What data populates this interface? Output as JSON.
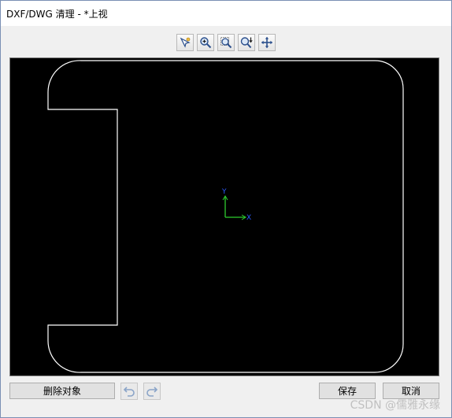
{
  "window": {
    "title": "DXF/DWG 清理 - *上视"
  },
  "toolbar": {
    "tools": [
      {
        "name": "select-pan-tool",
        "icon": "pointer-star-icon"
      },
      {
        "name": "zoom-in-tool",
        "icon": "zoom-in-icon"
      },
      {
        "name": "zoom-window-tool",
        "icon": "zoom-window-icon"
      },
      {
        "name": "zoom-fit-tool",
        "icon": "zoom-fit-icon"
      },
      {
        "name": "pan-tool",
        "icon": "move-arrows-icon"
      }
    ]
  },
  "viewport": {
    "background": "#000000",
    "outline_color": "#ffffff",
    "axis": {
      "x_label": "X",
      "y_label": "Y",
      "x_color": "#2ecc2e",
      "y_color": "#2e5cff"
    }
  },
  "buttons": {
    "delete_label": "删除对象",
    "save_label": "保存",
    "cancel_label": "取消"
  },
  "watermark": "CSDN @儒雅永缘"
}
